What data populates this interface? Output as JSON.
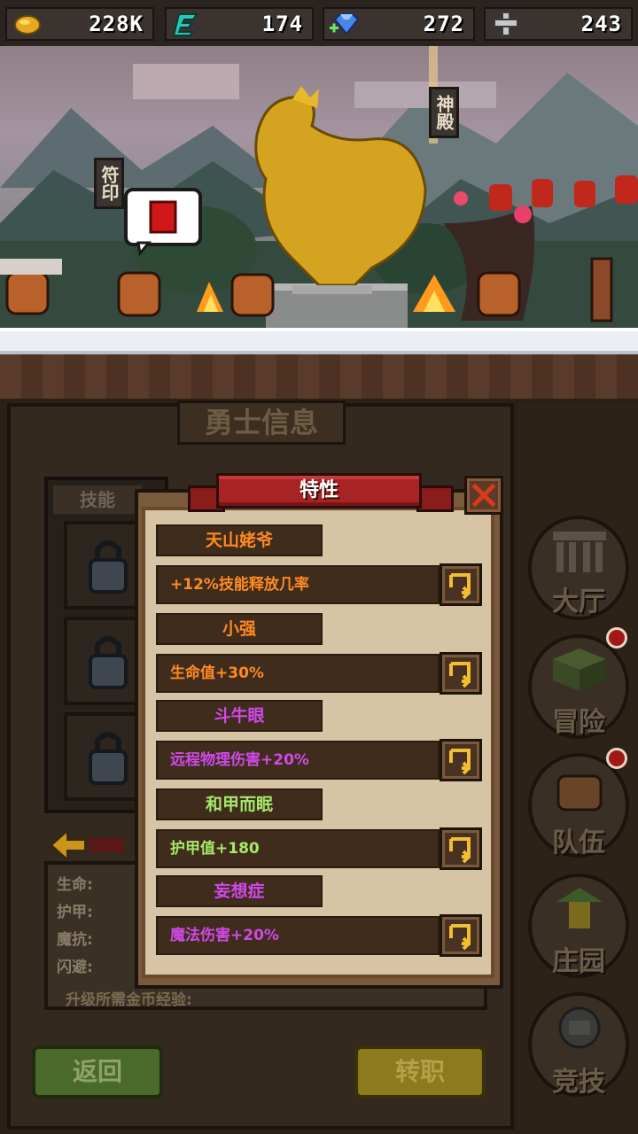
{
  "currencies": [
    {
      "icon": "gold-coin-icon",
      "value": "228K"
    },
    {
      "icon": "energy-icon",
      "value": "174"
    },
    {
      "icon": "diamond-icon",
      "value": "272"
    },
    {
      "icon": "medal-icon",
      "value": "243"
    }
  ],
  "scene": {
    "sign_left": "符印",
    "sign_right": "神殿"
  },
  "panel": {
    "title": "勇士信息",
    "skills_label": "技能",
    "stats": [
      "生命:",
      "护甲:",
      "魔抗:",
      "闪避:"
    ],
    "upgrade_label": "升级所需金币经验:",
    "back_button": "返回",
    "job_button": "转职"
  },
  "nav": [
    {
      "label": "大厅",
      "icon": "hall-icon"
    },
    {
      "label": "冒险",
      "icon": "adventure-icon"
    },
    {
      "label": "队伍",
      "icon": "team-icon"
    },
    {
      "label": "庄园",
      "icon": "manor-icon"
    },
    {
      "label": "竞技",
      "icon": "arena-icon"
    }
  ],
  "modal": {
    "title": "特性",
    "traits": [
      {
        "name": "天山姥爷",
        "effect": "+12%技能释放几率",
        "name_color": "orange",
        "effect_color": "orange"
      },
      {
        "name": "小强",
        "effect": "生命值+30%",
        "name_color": "orange",
        "effect_color": "orange"
      },
      {
        "name": "斗牛眼",
        "effect": "远程物理伤害+20%",
        "name_color": "purple",
        "effect_color": "purple"
      },
      {
        "name": "和甲而眠",
        "effect": "护甲值+180",
        "name_color": "lgreen",
        "effect_color": "lgreen"
      },
      {
        "name": "妄想症",
        "effect": "魔法伤害+20%",
        "name_color": "purple",
        "effect_color": "purple"
      }
    ]
  },
  "colors": {
    "orange": "#ff8a22",
    "purple": "#d049e8",
    "green": "#a6e86a",
    "ribbon": "#a62424"
  }
}
